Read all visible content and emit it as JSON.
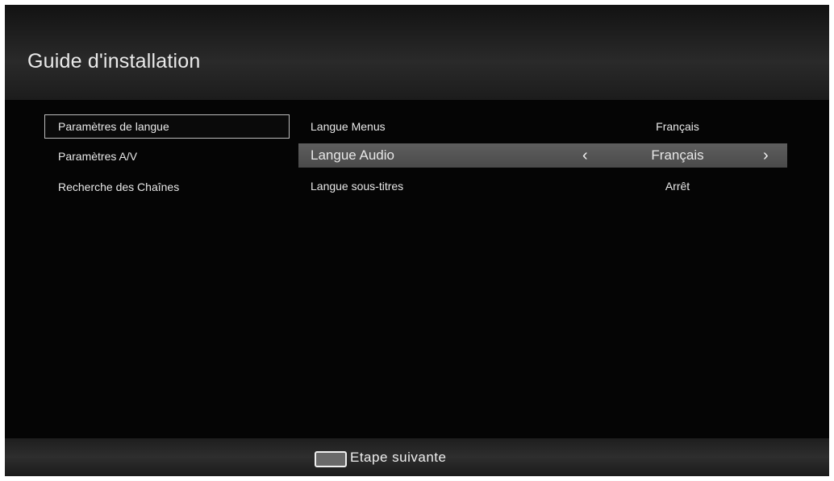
{
  "header": {
    "title": "Guide d'installation"
  },
  "sidebar": {
    "items": [
      {
        "label": "Paramètres de langue",
        "selected": true
      },
      {
        "label": "Paramètres A/V",
        "selected": false
      },
      {
        "label": "Recherche des Chaînes",
        "selected": false
      }
    ]
  },
  "settings": {
    "rows": [
      {
        "label": "Langue Menus",
        "value": "Français",
        "active": false
      },
      {
        "label": "Langue Audio",
        "value": "Français",
        "active": true
      },
      {
        "label": "Langue sous-titres",
        "value": "Arrêt",
        "active": false
      }
    ],
    "arrows": {
      "left": "‹",
      "right": "›"
    }
  },
  "footer": {
    "key_color": "green",
    "label": "Etape suivante"
  },
  "colors": {
    "background": "#080808",
    "highlight": "#555555",
    "text": "#e8e8e8"
  }
}
